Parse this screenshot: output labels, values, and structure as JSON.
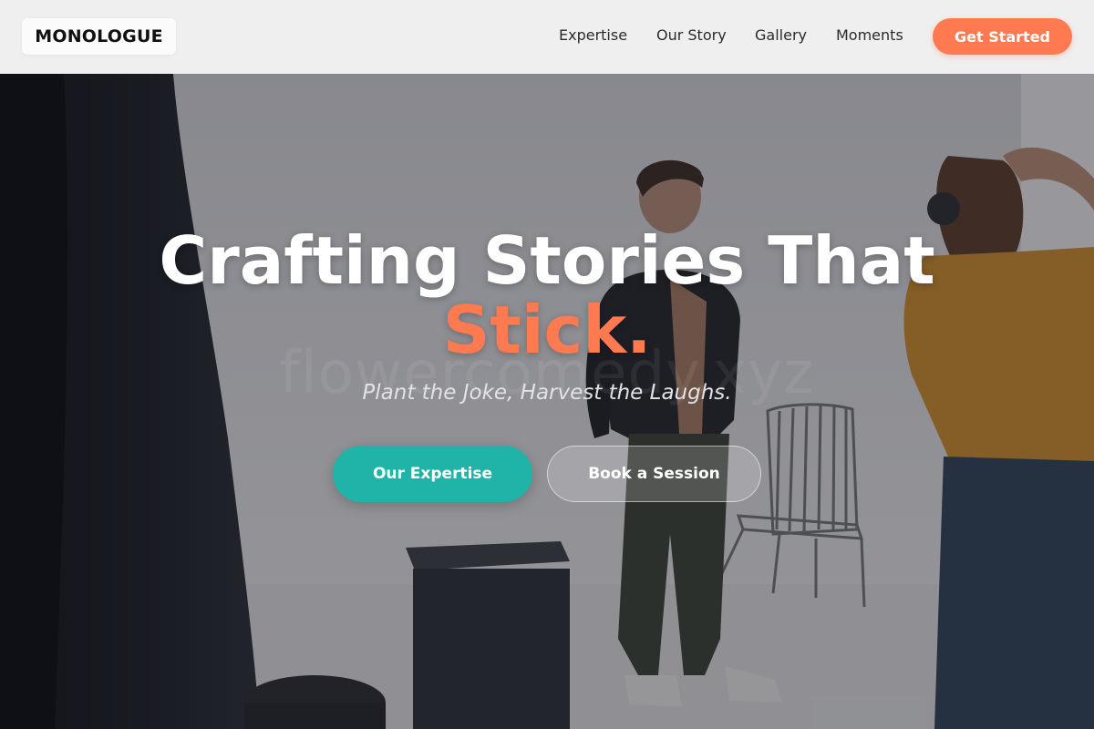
{
  "header": {
    "logo": "MONOLOGUE",
    "nav": [
      {
        "label": "Expertise"
      },
      {
        "label": "Our Story"
      },
      {
        "label": "Gallery"
      },
      {
        "label": "Moments"
      }
    ],
    "cta_label": "Get Started"
  },
  "hero": {
    "title_line1": "Crafting Stories That",
    "title_accent": "Stick.",
    "watermark": "flowercomedy.xyz",
    "subtitle": "Plant the Joke, Harvest the Laughs.",
    "primary_button": "Our Expertise",
    "secondary_button": "Book a Session",
    "background_image": "photo-studio-shoot"
  },
  "colors": {
    "accent": "#ff7a50",
    "primary_button": "#20b3a8",
    "header_bg": "#efefef"
  }
}
